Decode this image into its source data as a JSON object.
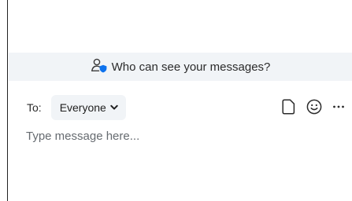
{
  "privacy_banner": {
    "text": "Who can see your messages?",
    "icon": "person-shield-icon"
  },
  "recipient": {
    "label": "To:",
    "selected": "Everyone",
    "icon": "chevron-down-icon"
  },
  "toolbar": {
    "icons": [
      "file-icon",
      "emoji-icon",
      "more-options-icon"
    ]
  },
  "composer": {
    "placeholder": "Type message here...",
    "value": ""
  },
  "colors": {
    "banner_bg": "#f1f4f7",
    "shield_accent": "#0e72ed",
    "text": "#2b2b2b"
  }
}
